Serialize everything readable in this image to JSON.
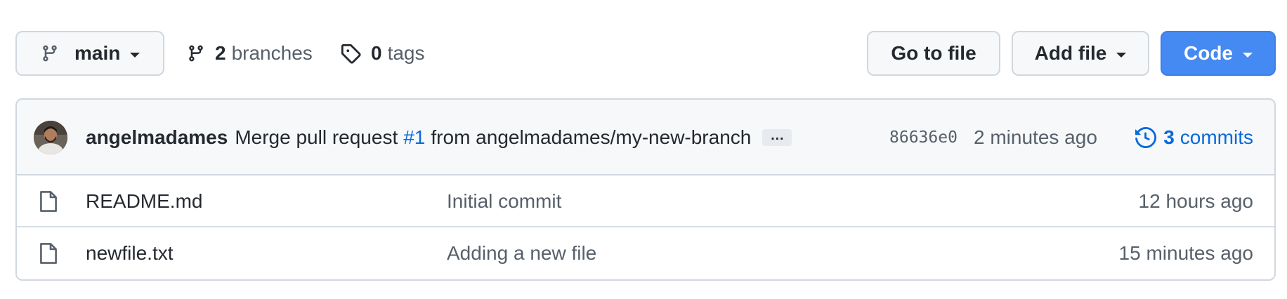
{
  "toolbar": {
    "branch_select": {
      "label": "main"
    },
    "branches": {
      "count": "2",
      "label": "branches"
    },
    "tags": {
      "count": "0",
      "label": "tags"
    },
    "goto_file_label": "Go to file",
    "add_file_label": "Add file",
    "code_label": "Code"
  },
  "latest_commit": {
    "author": "angelmadames",
    "message_prefix": "Merge pull request",
    "pr_ref": "#1",
    "message_suffix": "from angelmadames/my-new-branch",
    "ellipsis": "…",
    "sha": "86636e0",
    "time": "2 minutes ago",
    "commits_count": "3",
    "commits_label": "commits"
  },
  "files": [
    {
      "name": "README.md",
      "message": "Initial commit",
      "time": "12 hours ago",
      "icon": "file-icon"
    },
    {
      "name": "newfile.txt",
      "message": "Adding a new file",
      "time": "15 minutes ago",
      "icon": "file-icon"
    }
  ],
  "colors": {
    "accent": "#0969da",
    "primary_button": "#4589f3",
    "border": "#d0d7de",
    "muted_text": "#57606a",
    "header_bg": "#f6f8fa"
  }
}
